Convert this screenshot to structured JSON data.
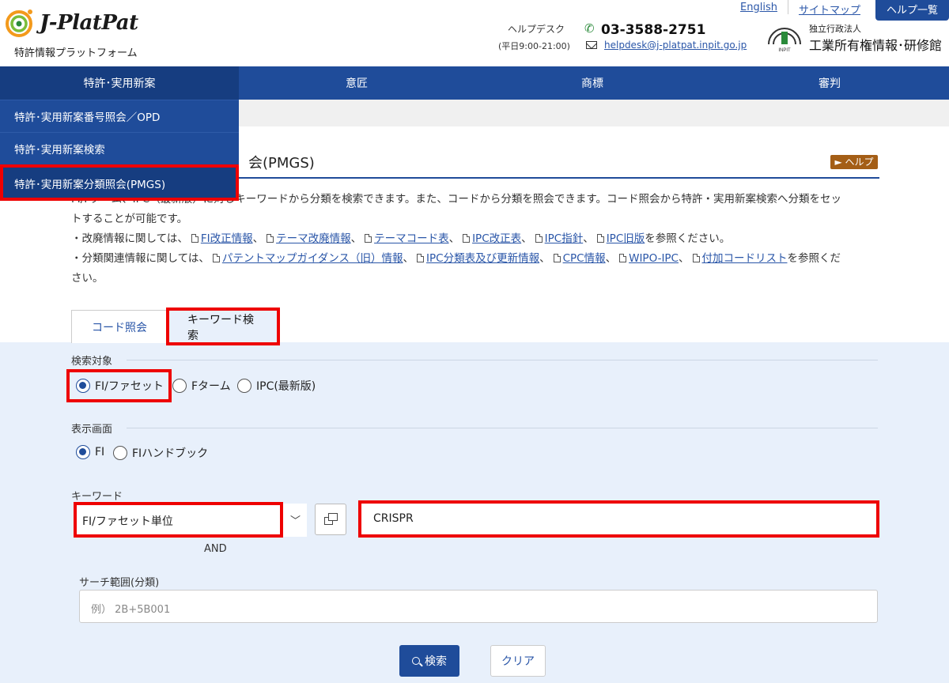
{
  "top_links": {
    "english": "English",
    "sitemap": "サイトマップ",
    "help_list": "ヘルプ一覧"
  },
  "logo": {
    "name": "J-PlatPat",
    "subtitle": "特許情報プラットフォーム"
  },
  "helpdesk": {
    "label": "ヘルプデスク",
    "hours": "(平日9:00-21:00)",
    "phone": "03-3588-2751",
    "email": "helpdesk@j-platpat.inpit.go.jp"
  },
  "inpit": {
    "sub": "独立行政法人",
    "name": "工業所有権情報･研修館"
  },
  "nav": [
    "特許･実用新案",
    "意匠",
    "商標",
    "審判"
  ],
  "dropdown": [
    "特許･実用新案番号照会／OPD",
    "特許･実用新案検索",
    "特許･実用新案分類照会(PMGS)"
  ],
  "page": {
    "title_visible": "会(PMGS)",
    "help_badge": "► ヘルプ",
    "desc_line1": "FI/Fターム、IPC（最新版）に対しキーワードから分類を検索できます。また、コードから分類を照会できます。コード照会から特許・実用新案検索へ分類をセッ",
    "desc_line2": "トすることが可能です。",
    "desc_line3_prefix": "・改廃情報に関しては、",
    "links1": [
      "FI改正情報",
      "テーマ改廃情報",
      "テーマコード表",
      "IPC改正表",
      "IPC指針",
      "IPC旧版"
    ],
    "desc_line3_suffix": "を参照ください。",
    "desc_line4_prefix": "・分類関連情報に関しては、",
    "links2": [
      "パテントマップガイダンス（旧）情報",
      "IPC分類表及び更新情報",
      "CPC情報",
      "WIPO-IPC",
      "付加コードリスト"
    ],
    "desc_line4_suffix": "を参照くだ",
    "desc_line5": "さい。"
  },
  "tabs": {
    "code": "コード照会",
    "keyword": "キーワード検索"
  },
  "search_target": {
    "label": "検索対象",
    "options": [
      "FI/ファセット",
      "Fターム",
      "IPC(最新版)"
    ],
    "selected": "FI/ファセット"
  },
  "display": {
    "label": "表示画面",
    "options": [
      "FI",
      "FIハンドブック"
    ],
    "selected": "FI"
  },
  "keyword": {
    "label": "キーワード",
    "unit_select": "FI/ファセット単位",
    "value": "CRISPR",
    "and": "AND"
  },
  "range": {
    "label": "サーチ範囲(分類)",
    "placeholder": "例） 2B+5B001"
  },
  "buttons": {
    "search": "検索",
    "clear": "クリア"
  }
}
